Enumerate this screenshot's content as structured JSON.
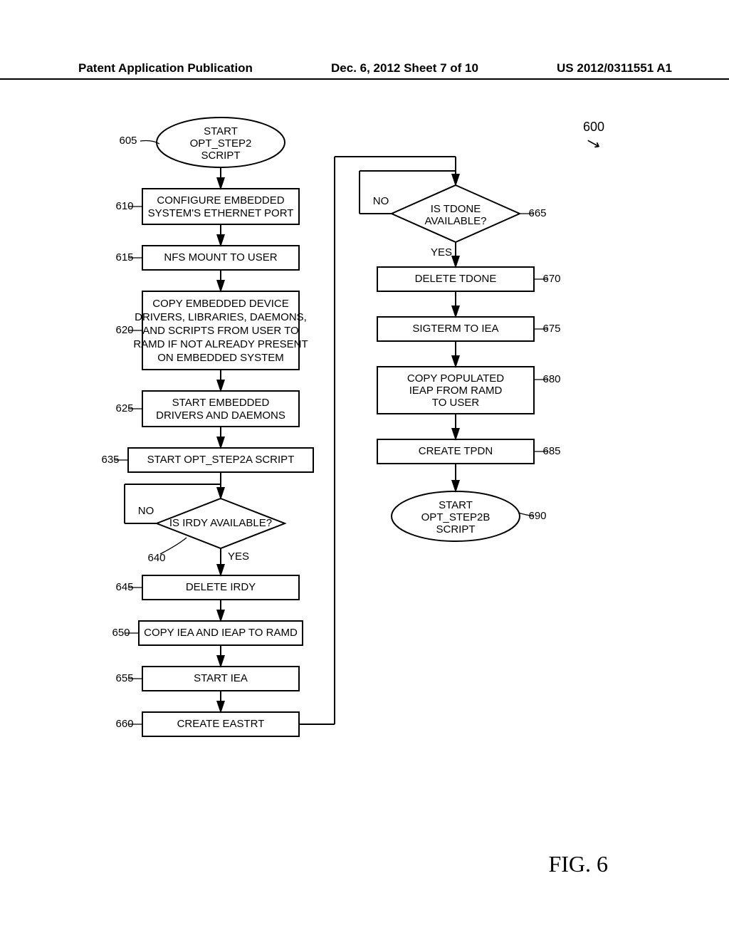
{
  "header": {
    "left": "Patent Application Publication",
    "center": "Dec. 6, 2012  Sheet 7 of 10",
    "right": "US 2012/0311551 A1"
  },
  "figure_label": "FIG. 6",
  "ref_600": "600",
  "labels": {
    "l605": "605",
    "l610": "610",
    "l615": "615",
    "l620": "620",
    "l625": "625",
    "l635": "635",
    "l640": "640",
    "l645": "645",
    "l650": "650",
    "l655": "655",
    "l660": "660",
    "l665": "665",
    "l670": "670",
    "l675": "675",
    "l680": "680",
    "l685": "685",
    "l690": "690"
  },
  "nodes": {
    "n605_l1": "START",
    "n605_l2": "OPT_STEP2",
    "n605_l3": "SCRIPT",
    "n610_l1": "CONFIGURE EMBEDDED",
    "n610_l2": "SYSTEM'S ETHERNET PORT",
    "n615": "NFS MOUNT TO USER",
    "n620_l1": "COPY EMBEDDED DEVICE",
    "n620_l2": "DRIVERS, LIBRARIES, DAEMONS,",
    "n620_l3": "AND SCRIPTS FROM USER TO",
    "n620_l4": "RAMD IF NOT ALREADY PRESENT",
    "n620_l5": "ON EMBEDDED SYSTEM",
    "n625_l1": "START EMBEDDED",
    "n625_l2": "DRIVERS AND DAEMONS",
    "n635": "START OPT_STEP2A SCRIPT",
    "n640": "IS IRDY AVAILABLE?",
    "n640_no": "NO",
    "n640_yes": "YES",
    "n645": "DELETE IRDY",
    "n650": "COPY IEA AND IEAP TO RAMD",
    "n655": "START IEA",
    "n660": "CREATE EASTRT",
    "n665_l1": "IS TDONE",
    "n665_l2": "AVAILABLE?",
    "n665_no": "NO",
    "n665_yes": "YES",
    "n670": "DELETE TDONE",
    "n675": "SIGTERM TO IEA",
    "n680_l1": "COPY POPULATED",
    "n680_l2": "IEAP FROM RAMD",
    "n680_l3": "TO USER",
    "n685": "CREATE TPDN",
    "n690_l1": "START",
    "n690_l2": "OPT_STEP2B",
    "n690_l3": "SCRIPT"
  }
}
